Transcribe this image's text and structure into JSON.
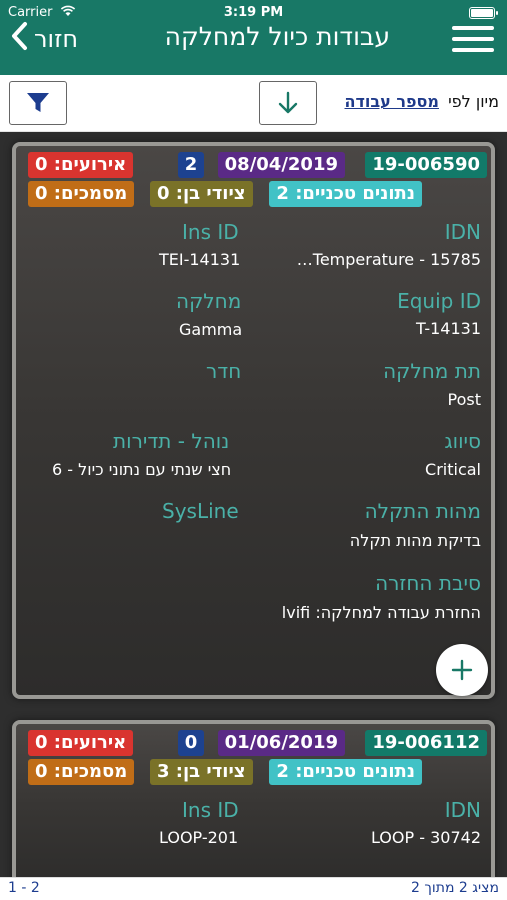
{
  "status": {
    "carrier": "Carrier",
    "time": "3:19 PM"
  },
  "header": {
    "title": "עבודות כיול למחלקה",
    "back_label": "חזור"
  },
  "toolbar": {
    "sort_prefix": "מיון לפי",
    "sort_field": "מספר עבודה"
  },
  "labels": {
    "idn": "IDN",
    "ins_id": "Ins ID",
    "equip_id": "Equip ID",
    "department": "מחלקה",
    "sub_department": "תת מחלקה",
    "room": "חדר",
    "classification": "סיווג",
    "procedure": "נוהל - תדירות",
    "fault_nature": "מהות התקלה",
    "sysline": "SysLine",
    "return_reason": "סיבת החזרה"
  },
  "cards": [
    {
      "job_id": "19-006590",
      "date": "08/04/2019",
      "num": "2",
      "events": "אירועים: 0",
      "tech_data": "נתונים טכניים: 2",
      "sub_equipment": "ציודי בן: 0",
      "documents": "מסמכים: 0",
      "idn": "15785 - Temperature…",
      "ins_id": "TEI-14131",
      "equip_id": "T-14131",
      "department": "Gamma",
      "sub_department": "Post",
      "room": "",
      "classification": "Critical",
      "procedure": "חצי שנתי עם נתוני כיול - 6",
      "fault_nature": "בדיקת מהות תקלה",
      "sysline": "",
      "return_reason": "החזרת עבודה למחלקה: lvifi"
    },
    {
      "job_id": "19-006112",
      "date": "01/06/2019",
      "num": "0",
      "events": "אירועים: 0",
      "tech_data": "נתונים טכניים: 2",
      "sub_equipment": "ציודי בן: 3",
      "documents": "מסמכים: 0",
      "idn": "30742 - LOOP",
      "ins_id": "LOOP-201"
    }
  ],
  "footer": {
    "showing": "מציג 2 מתוך 2",
    "range": "1 - 2"
  },
  "colors": {
    "brand": "#187866",
    "accent": "#4ab1a8"
  }
}
